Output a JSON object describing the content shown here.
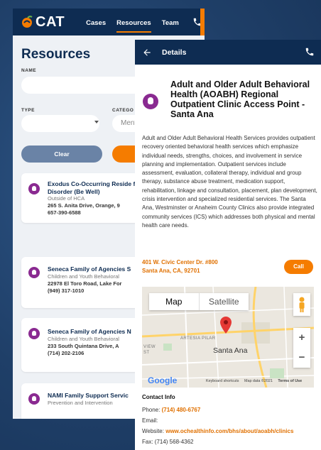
{
  "brand": {
    "logo_text": "CAT",
    "colors": {
      "navy": "#0e2c52",
      "orange": "#f57c00",
      "purple": "#8a2a91",
      "background": "#1f3f68"
    }
  },
  "nav": {
    "links": [
      "Cases",
      "Resources",
      "Team"
    ],
    "active": "Resources",
    "phone_icon": "phone-icon"
  },
  "resources_page": {
    "title": "Resources",
    "name_label": "NAME",
    "type_label": "TYPE",
    "category_label": "CATEGO",
    "category_value": "Ment",
    "clear_label": "Clear",
    "cards": [
      {
        "title": "Exodus Co-Occurring Reside for Mental Health and Subst Disorder (Be Well)",
        "subtitle": "Outside of HCA",
        "address": "265 S. Anita Drive, Orange, 9",
        "phone": "657-390-6588"
      },
      {
        "title": "Seneca Family of Agencies S",
        "subtitle": "Children and Youth Behavioral",
        "address": "22978 El Toro Road, Lake For",
        "phone": "(949) 317-1010"
      },
      {
        "title": "Seneca Family of Agencies N",
        "subtitle": "Children and Youth Behavioral",
        "address": "233 South Quintana Drive, A",
        "phone": "(714) 202-2106"
      },
      {
        "title": "NAMI Family Support Servic",
        "subtitle": "Prevention and Intervention",
        "address": "",
        "phone": ""
      }
    ]
  },
  "details": {
    "header_title": "Details",
    "org_name": "Adult and Older Adult Behavioral Health (AOABH) Regional Outpatient Clinic Access Point - Santa Ana",
    "description": "Adult and Older Adult Behavioral Health Services provides outpatient recovery oriented behavioral health services which emphasize individual needs, strengths, choices, and involvement in service planning and implementation. Outpatient services include assessment, evaluation, collateral therapy, individual and group therapy, substance abuse treatment, medication support, rehabilitation, linkage and consultation, placement, plan development, crisis intervention and specialized residential services. The Santa Ana, Westminster or Anaheim County Clinics also provide integrated community services (ICS) which addresses both physical and mental health care needs.",
    "address_line1": "401 W. Civic Center Dr. #800",
    "address_line2": "Santa Ana, CA, 92701",
    "call_label": "Call",
    "map": {
      "map_label": "Map",
      "satellite_label": "Satellite",
      "city_label": "Santa Ana",
      "area_label": "ARTESIA PILAR",
      "view_label": "VIEW",
      "st_label": "ST",
      "google_label": "Google",
      "shortcuts_label": "Keyboard shortcuts",
      "mapdata_label": "Map data ©2021",
      "terms_label": "Terms of Use",
      "zoom_in": "+",
      "zoom_out": "−"
    },
    "contact": {
      "heading": "Contact Info",
      "phone_label": "Phone:",
      "phone": "(714) 480-6767",
      "email_label": "Email:",
      "website_label": "Website:",
      "website": "www.ochealthinfo.com/bhs/about/aoabh/clinics",
      "fax": "Fax: (714) 568-4362"
    }
  }
}
